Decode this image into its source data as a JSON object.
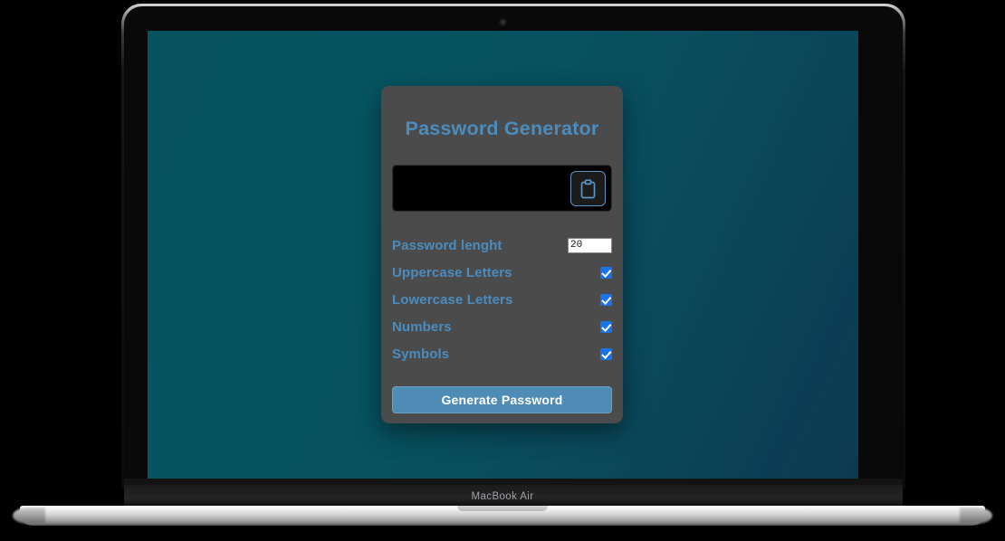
{
  "device": {
    "model_label": "MacBook Air",
    "camera_icon": "camera-dot"
  },
  "screen": {
    "background_start": "#075460",
    "background_end": "#0c3a52"
  },
  "app": {
    "title": "Password Generator",
    "accent_color": "#4b8cbe",
    "card_color": "#4b4b4b",
    "password_output": {
      "value": "",
      "placeholder": ""
    },
    "copy_button": {
      "icon": "clipboard-icon"
    },
    "length": {
      "label": "Password lenght",
      "value": "20"
    },
    "options": [
      {
        "label": "Uppercase Letters",
        "checked": true
      },
      {
        "label": "Lowercase Letters",
        "checked": true
      },
      {
        "label": "Numbers",
        "checked": true
      },
      {
        "label": "Symbols",
        "checked": true
      }
    ],
    "generate_button": {
      "label": "Generate Password",
      "color": "#4f8cb5"
    }
  }
}
